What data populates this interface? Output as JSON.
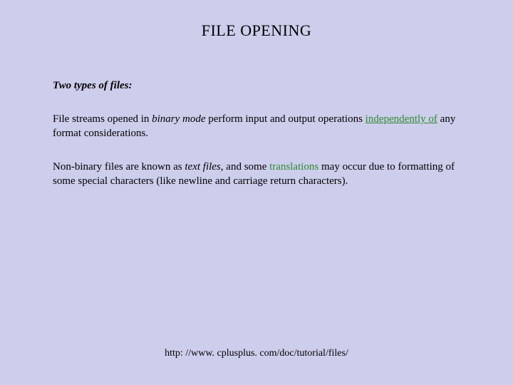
{
  "title": "FILE OPENING",
  "subhead": "Two types of files:",
  "p1": {
    "t1": "File streams opened in ",
    "t2": "binary mode",
    "t3": " perform input and output operations ",
    "t4": "independently of",
    "t5": " any format considerations."
  },
  "p2": {
    "t1": "Non-binary files are known as ",
    "t2": "text files",
    "t3": ", and some ",
    "t4": "translations",
    "t5": " may occur due to formatting of some special characters (like newline and carriage return characters)."
  },
  "footer": "http: //www. cplusplus. com/doc/tutorial/files/"
}
